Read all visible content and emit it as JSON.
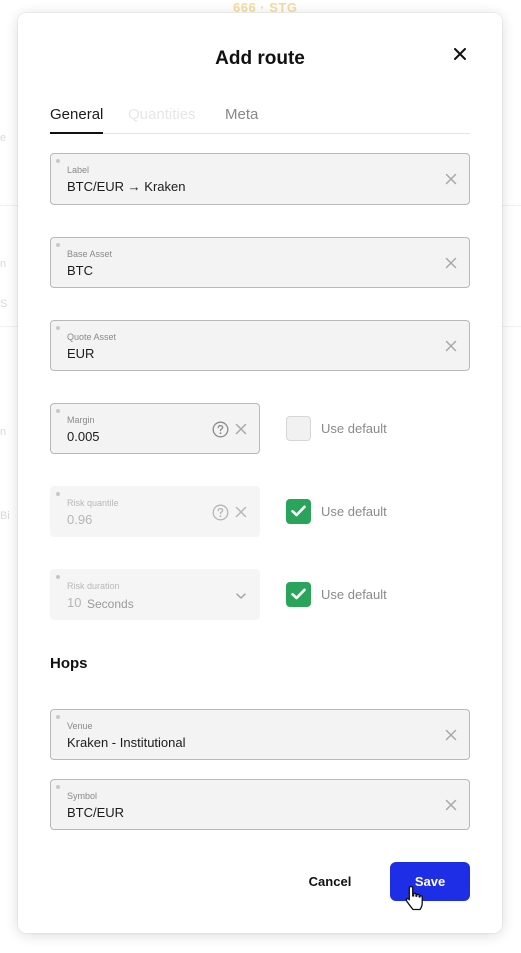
{
  "background": {
    "top_text": "666 · STG",
    "edge_texts": [
      "e",
      "n",
      "S",
      "n",
      "Bi",
      "Bi"
    ]
  },
  "modal": {
    "title": "Add route",
    "tabs": [
      {
        "label": "General",
        "state": "active"
      },
      {
        "label": "Quantities",
        "state": "disabled"
      },
      {
        "label": "Meta",
        "state": "inactive"
      }
    ],
    "general": {
      "label_field": {
        "label": "Label",
        "value": "BTC/EUR → Kraken"
      },
      "base_asset": {
        "label": "Base Asset",
        "value": "BTC"
      },
      "quote_asset": {
        "label": "Quote Asset",
        "value": "EUR"
      },
      "margin": {
        "label": "Margin",
        "value": "0.005",
        "use_default_label": "Use default",
        "use_default": false
      },
      "risk_quantile": {
        "label": "Risk quantile",
        "value": "0.96",
        "use_default_label": "Use default",
        "use_default": true
      },
      "risk_duration": {
        "label": "Risk duration",
        "value": "10",
        "unit": "Seconds",
        "use_default_label": "Use default",
        "use_default": true
      }
    },
    "hops": {
      "title": "Hops",
      "venue": {
        "label": "Venue",
        "value": "Kraken - Institutional"
      },
      "symbol": {
        "label": "Symbol",
        "value": "BTC/EUR"
      }
    },
    "actions": {
      "cancel_label": "Cancel",
      "save_label": "Save"
    }
  },
  "colors": {
    "primary": "#1e2ee6",
    "checkbox_checked": "#2aa45a",
    "field_bg": "#f3f3f3"
  }
}
